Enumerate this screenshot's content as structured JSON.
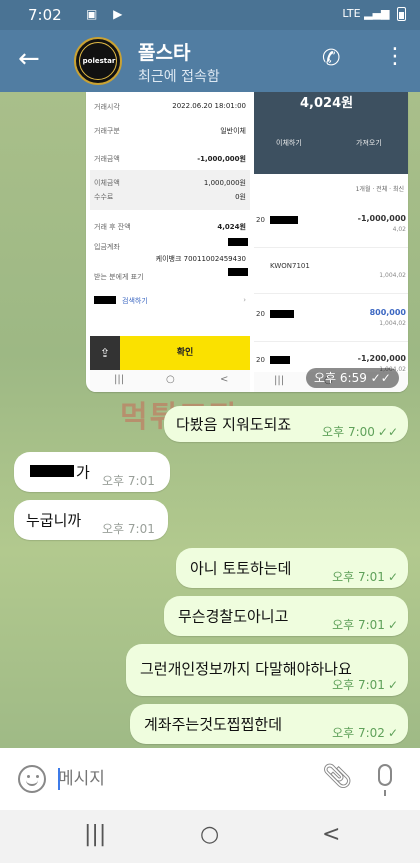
{
  "status_bar": {
    "time": "7:02",
    "icons": "▣ ▶",
    "network": "LTE"
  },
  "header": {
    "back_icon": "←",
    "avatar_text": "polestar",
    "title": "폴스타",
    "subtitle": "최근에 접속함",
    "phone_icon": "✆",
    "more_icon": "⋮"
  },
  "image_message": {
    "receipt": {
      "rows": [
        {
          "key": "거래시각",
          "value": "2022.06.20 18:01:00"
        },
        {
          "key": "거래구분",
          "value": "일반이체"
        },
        {
          "key": "거래금액",
          "value": "-1,000,000원"
        },
        {
          "key": "이체금액",
          "value": "1,000,000원"
        },
        {
          "key": "수수료",
          "value": "0원"
        },
        {
          "key": "거래 후 잔액",
          "value": "4,024원"
        },
        {
          "key": "입금계좌",
          "value": ""
        },
        {
          "key": "",
          "value": "케이뱅크 70011002459430"
        },
        {
          "key": "받는 분에게 표기",
          "value": ""
        },
        {
          "key": "",
          "value": "검색하기"
        }
      ],
      "confirm_label": "확인",
      "share_icon": "⇪",
      "nav": [
        "|||",
        "○",
        "<"
      ]
    },
    "bank": {
      "balance": "4,024원",
      "btn_transfer": "이체하기",
      "btn_bring": "가져오기",
      "filter": "1개월 · 전체 · 최신",
      "entries": [
        {
          "left": "20",
          "amount": "-1,000,000",
          "sub": "4,02"
        },
        {
          "left": "KWON7101",
          "amount": "",
          "sub": "1,004,02"
        },
        {
          "left": "20",
          "amount": "800,000",
          "sub": "1,004,02"
        },
        {
          "left": "20",
          "amount": "-1,200,000",
          "sub": "1,004,02"
        }
      ],
      "nav": [
        "|||",
        "○"
      ]
    },
    "timestamp": "오후 6:59"
  },
  "watermark": "먹튀조직",
  "messages": [
    {
      "dir": "out",
      "text": "다봤음 지워도되죠",
      "time": "오후 7:00",
      "status": "read"
    },
    {
      "dir": "in",
      "text": "가",
      "time": "오후 7:01"
    },
    {
      "dir": "in",
      "text": "누굽니까",
      "time": "오후 7:01"
    },
    {
      "dir": "out",
      "text": "아니 토토하는데",
      "time": "오후 7:01",
      "status": "sent"
    },
    {
      "dir": "out",
      "text": "무슨경찰도아니고",
      "time": "오후 7:01",
      "status": "sent"
    },
    {
      "dir": "out",
      "text": "그런개인정보까지 다말해야하나요",
      "time": "오후 7:01",
      "status": "sent"
    },
    {
      "dir": "out",
      "text": "계좌주는것도찝찝한데",
      "time": "오후 7:02",
      "status": "sent"
    }
  ],
  "input": {
    "placeholder": "메시지"
  },
  "nav": {
    "recents": "|||",
    "home": "○",
    "back": "<"
  },
  "colors": {
    "header": "#517da2",
    "status_bar": "#4a7394",
    "out_bubble": "#effdde",
    "confirm_button": "#fae100"
  }
}
